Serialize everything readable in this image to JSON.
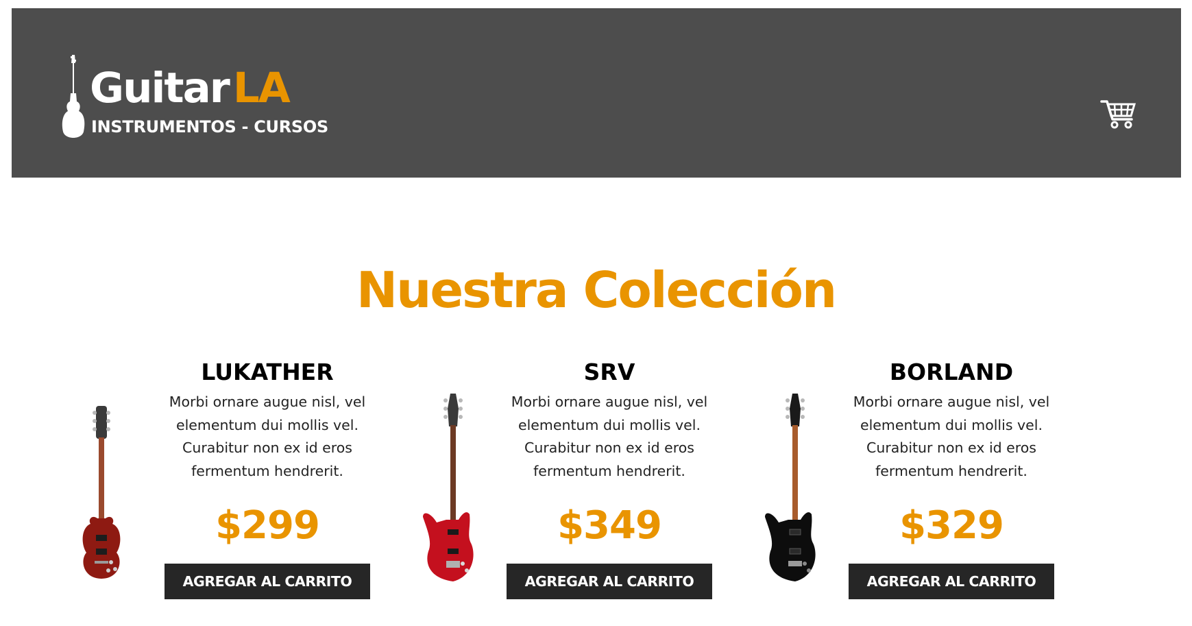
{
  "header": {
    "logo": {
      "word_white": "Guitar",
      "word_accent": "LA",
      "tagline": "INSTRUMENTOS - CURSOS"
    },
    "cart_icon": "shopping-cart-icon"
  },
  "colors": {
    "header_bg": "#4d4d4d",
    "accent": "#e99400",
    "button_bg": "#262626",
    "text": "#000000"
  },
  "main": {
    "title": "Nuestra Colección",
    "products": [
      {
        "name": "LUKATHER",
        "description": "Morbi ornare augue nisl, vel elementum dui mollis vel. Curabitur non ex id eros fermentum hendrerit.",
        "price": "$299",
        "button_label": "AGREGAR AL CARRITO",
        "image_icon": "cherry-les-paul-guitar-image",
        "body_color": "#8e1a12"
      },
      {
        "name": "SRV",
        "description": "Morbi ornare augue nisl, vel elementum dui mollis vel. Curabitur non ex id eros fermentum hendrerit.",
        "price": "$349",
        "button_label": "AGREGAR AL CARRITO",
        "image_icon": "red-superstrat-guitar-image",
        "body_color": "#c4101e"
      },
      {
        "name": "BORLAND",
        "description": "Morbi ornare augue nisl, vel elementum dui mollis vel. Curabitur non ex id eros fermentum hendrerit.",
        "price": "$329",
        "button_label": "AGREGAR AL CARRITO",
        "image_icon": "black-superstrat-guitar-image",
        "body_color": "#0d0d0d"
      }
    ]
  }
}
